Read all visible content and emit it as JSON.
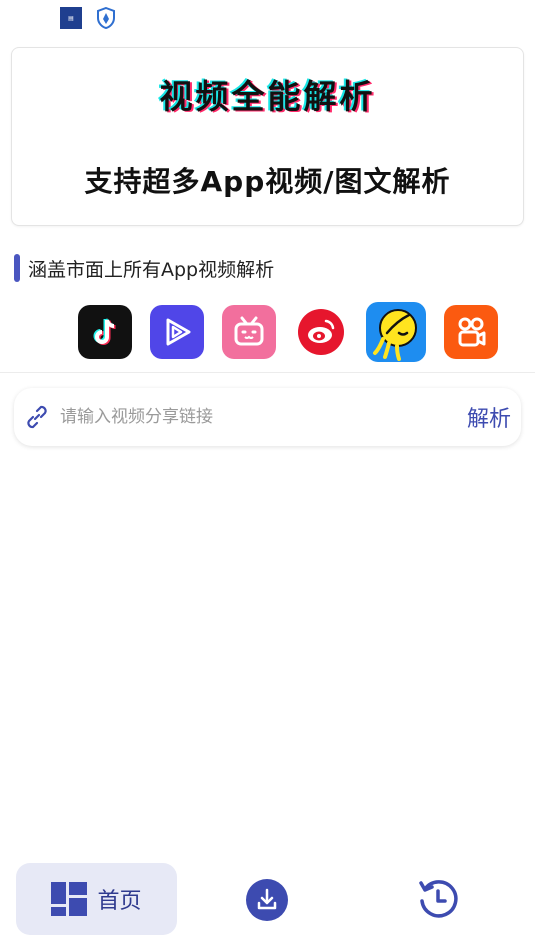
{
  "status_bar": {
    "icons": [
      "news-app-icon",
      "shield-app-icon"
    ]
  },
  "banner": {
    "title": "视频全能解析",
    "subtitle": "支持超多App视频/图文解析"
  },
  "section": {
    "title": "涵盖市面上所有App视频解析"
  },
  "apps": [
    {
      "name": "douyin-icon",
      "color": "#111111"
    },
    {
      "name": "video-play-icon",
      "color": "#5046e8"
    },
    {
      "name": "bilibili-icon",
      "color": "#f26f9d"
    },
    {
      "name": "weibo-icon",
      "color": "#e6162d"
    },
    {
      "name": "qq-icon",
      "color": "#1e8df0"
    },
    {
      "name": "kuaishou-icon",
      "color": "#fb5a10"
    }
  ],
  "search": {
    "placeholder": "请输入视频分享链接",
    "value": "",
    "button_label": "解析"
  },
  "tabbar": {
    "home_label": "首页",
    "accent": "#3d4bb0"
  }
}
